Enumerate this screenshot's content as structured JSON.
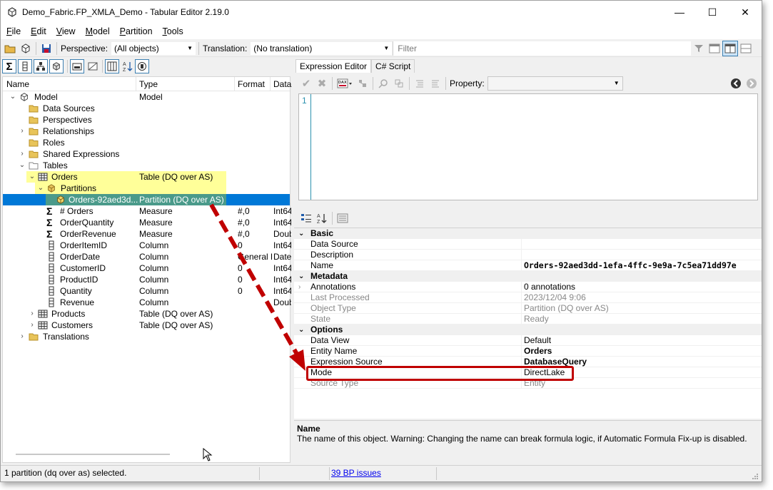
{
  "window": {
    "title": "Demo_Fabric.FP_XMLA_Demo - Tabular Editor 2.19.0",
    "controls": {
      "minimize": "—",
      "maximize": "☐",
      "close": "✕"
    }
  },
  "menu": {
    "items": [
      {
        "first": "F",
        "rest": "ile"
      },
      {
        "first": "E",
        "rest": "dit"
      },
      {
        "first": "V",
        "rest": "iew"
      },
      {
        "first": "M",
        "rest": "odel"
      },
      {
        "first": "P",
        "rest": "artition"
      },
      {
        "first": "T",
        "rest": "ools"
      }
    ]
  },
  "toolbar": {
    "perspective_label": "Perspective:",
    "perspective_value": "(All objects)",
    "translation_label": "Translation:",
    "translation_value": "(No translation)",
    "filter_placeholder": "Filter"
  },
  "tree": {
    "columns": {
      "name": "Name",
      "type": "Type",
      "format": "Format",
      "data": "Data"
    },
    "rows": [
      {
        "name": "Model",
        "type": "Model",
        "format": "",
        "data": ""
      },
      {
        "name": "Data Sources",
        "type": "",
        "format": "",
        "data": ""
      },
      {
        "name": "Perspectives",
        "type": "",
        "format": "",
        "data": ""
      },
      {
        "name": "Relationships",
        "type": "",
        "format": "",
        "data": ""
      },
      {
        "name": "Roles",
        "type": "",
        "format": "",
        "data": ""
      },
      {
        "name": "Shared Expressions",
        "type": "",
        "format": "",
        "data": ""
      },
      {
        "name": "Tables",
        "type": "",
        "format": "",
        "data": ""
      },
      {
        "name": "Orders",
        "type": "Table (DQ over AS)",
        "format": "",
        "data": ""
      },
      {
        "name": "Partitions",
        "type": "",
        "format": "",
        "data": ""
      },
      {
        "name": "Orders-92aed3d...",
        "type": "Partition (DQ over AS)",
        "format": "",
        "data": ""
      },
      {
        "name": "# Orders",
        "type": "Measure",
        "format": "#,0",
        "data": "Int64"
      },
      {
        "name": "OrderQuantity",
        "type": "Measure",
        "format": "#,0",
        "data": "Int64"
      },
      {
        "name": "OrderRevenue",
        "type": "Measure",
        "format": "#,0",
        "data": "Double"
      },
      {
        "name": "OrderItemID",
        "type": "Column",
        "format": "0",
        "data": "Int64"
      },
      {
        "name": "OrderDate",
        "type": "Column",
        "format": "General Date",
        "data": "DateTime"
      },
      {
        "name": "CustomerID",
        "type": "Column",
        "format": "0",
        "data": "Int64"
      },
      {
        "name": "ProductID",
        "type": "Column",
        "format": "0",
        "data": "Int64"
      },
      {
        "name": "Quantity",
        "type": "Column",
        "format": "0",
        "data": "Int64"
      },
      {
        "name": "Revenue",
        "type": "Column",
        "format": "",
        "data": "Double"
      },
      {
        "name": "Products",
        "type": "Table (DQ over AS)",
        "format": "",
        "data": ""
      },
      {
        "name": "Customers",
        "type": "Table (DQ over AS)",
        "format": "",
        "data": ""
      },
      {
        "name": "Translations",
        "type": "",
        "format": "",
        "data": ""
      }
    ]
  },
  "tabs": {
    "expression_editor": "Expression Editor",
    "csharp_script": "C# Script"
  },
  "expression_toolbar": {
    "property_label": "Property:",
    "property_value": ""
  },
  "editor": {
    "line_number": "1"
  },
  "properties": {
    "basic": {
      "label": "Basic",
      "data_source": {
        "name": "Data Source",
        "value": ""
      },
      "description": {
        "name": "Description",
        "value": ""
      },
      "name": {
        "name": "Name",
        "value": "Orders-92aed3dd-1efa-4ffc-9e9a-7c5ea71dd97e"
      }
    },
    "metadata": {
      "label": "Metadata",
      "annotations": {
        "name": "Annotations",
        "value": "0 annotations"
      },
      "last_processed": {
        "name": "Last Processed",
        "value": "2023/12/04 9:06"
      },
      "object_type": {
        "name": "Object Type",
        "value": "Partition (DQ over AS)"
      },
      "state": {
        "name": "State",
        "value": "Ready"
      }
    },
    "options": {
      "label": "Options",
      "data_view": {
        "name": "Data View",
        "value": "Default"
      },
      "entity_name": {
        "name": "Entity Name",
        "value": "Orders"
      },
      "expression_source": {
        "name": "Expression Source",
        "value": "DatabaseQuery"
      },
      "mode": {
        "name": "Mode",
        "value": "DirectLake"
      },
      "source_type": {
        "name": "Source Type",
        "value": "Entity"
      }
    }
  },
  "description_panel": {
    "title": "Name",
    "text": "The name of this object. Warning: Changing the name can break formula logic, if Automatic Formula Fix-up is disabled."
  },
  "statusbar": {
    "selection_text": "1 partition (dq over as) selected.",
    "bp_issues_link": "39 BP issues"
  },
  "colors": {
    "selection": "#0078d7",
    "highlight": "#ffff99",
    "annotation": "#c00000",
    "link": "#0000ee"
  }
}
